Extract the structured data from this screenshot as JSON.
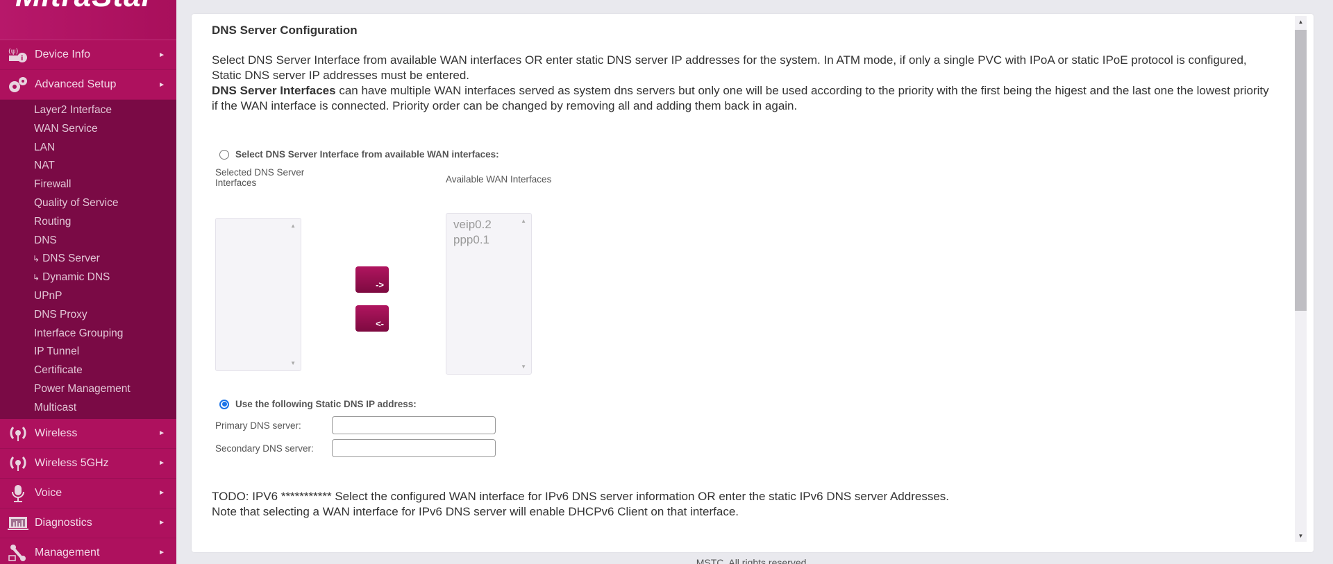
{
  "brand": {
    "logo": "MitraStar",
    "accent": "#b0125f",
    "submenu_bg": "#7a0a45"
  },
  "sidebar": {
    "items": [
      {
        "label": "Device Info",
        "icon": "device-info-icon"
      },
      {
        "label": "Advanced Setup",
        "icon": "gears-icon"
      },
      {
        "label": "Wireless",
        "icon": "wireless-icon"
      },
      {
        "label": "Wireless 5GHz",
        "icon": "wireless-icon"
      },
      {
        "label": "Voice",
        "icon": "microphone-icon"
      },
      {
        "label": "Diagnostics",
        "icon": "diagnostics-icon"
      },
      {
        "label": "Management",
        "icon": "wrench-icon"
      }
    ],
    "submenu": [
      "Layer2 Interface",
      "WAN Service",
      "LAN",
      "NAT",
      "Firewall",
      "Quality of Service",
      "Routing",
      "DNS",
      "DNS Server",
      "Dynamic DNS",
      "UPnP",
      "DNS Proxy",
      "Interface Grouping",
      "IP Tunnel",
      "Certificate",
      "Power Management",
      "Multicast"
    ],
    "arrow": "►",
    "hook": "↳"
  },
  "page": {
    "title": "DNS Server Configuration",
    "desc1": "Select DNS Server Interface from available WAN interfaces OR enter static DNS server IP addresses for the system. In ATM mode, if only a single PVC with IPoA or static IPoE protocol is configured, Static DNS server IP addresses must be entered.",
    "desc2_bold": "DNS Server Interfaces",
    "desc2": " can have multiple WAN interfaces served as system dns servers but only one will be used according to the priority with the first being the higest and the last one the lowest priority if the WAN interface is connected. Priority order can be changed by removing all and adding them back in again.",
    "radio_wan_label": "Select DNS Server Interface from available WAN interfaces:",
    "selected_label": "Selected DNS Server Interfaces",
    "available_label": "Available WAN Interfaces",
    "selected_items": [],
    "available_items": [
      "veip0.2",
      "ppp0.1"
    ],
    "add_btn": "->",
    "remove_btn": "<-",
    "radio_static_label": "Use the following Static DNS IP address:",
    "primary_label": "Primary DNS server:",
    "primary_value": "",
    "secondary_label": "Secondary DNS server:",
    "secondary_value": "",
    "ipv6_line1": "TODO: IPV6 *********** Select the configured WAN interface for IPv6 DNS server information OR enter the static IPv6 DNS server Addresses.",
    "ipv6_line2": "Note that selecting a WAN interface for IPv6 DNS server will enable DHCPv6 Client on that interface.",
    "selected_mode": "static"
  },
  "footer": "MSTC. All rights reserved."
}
